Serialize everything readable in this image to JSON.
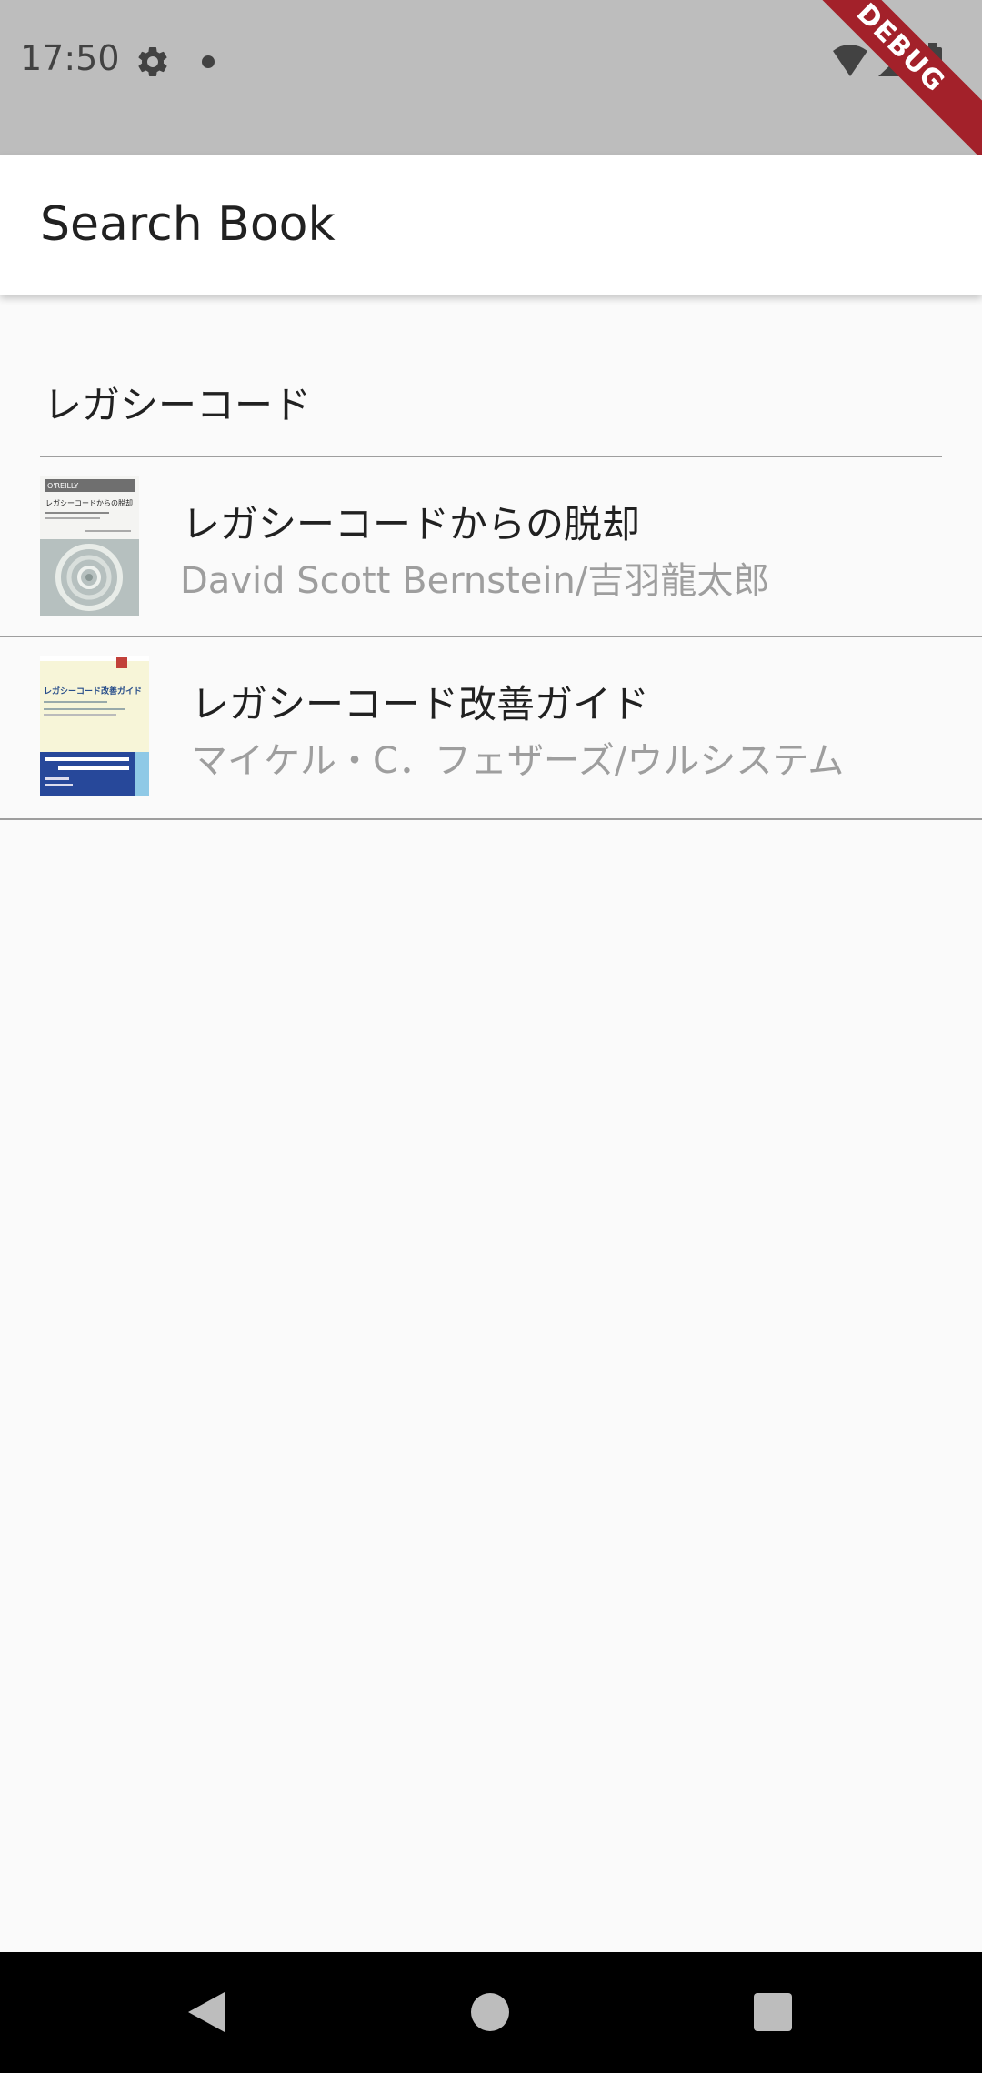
{
  "status_bar": {
    "time": "17:50",
    "icons": [
      "gear-icon",
      "notification-dot-icon",
      "wifi-icon",
      "cell-signal-icon",
      "battery-icon"
    ],
    "debug_label": "DEBUG",
    "background": "#bdbdbd",
    "debug_color": "#a3212a"
  },
  "app_bar": {
    "title": "Search Book"
  },
  "search": {
    "value": "レガシーコード"
  },
  "books": [
    {
      "title": "レガシーコードからの脱却",
      "authors": "David Scott Bernstein/吉羽龍太郎",
      "cover_text": "レガシーコードからの脱却"
    },
    {
      "title": "レガシーコード改善ガイド",
      "authors": "マイケル・C．フェザーズ/ウルシステム",
      "cover_text": "レガシーコード改善ガイド"
    }
  ],
  "nav_bar": {
    "icons": [
      "back-icon",
      "home-icon",
      "recents-icon"
    ]
  },
  "colors": {
    "title_text": "#212121",
    "secondary_text": "#9e9e9e",
    "divider": "#9e9e9e",
    "page_bg": "#fafafa"
  }
}
